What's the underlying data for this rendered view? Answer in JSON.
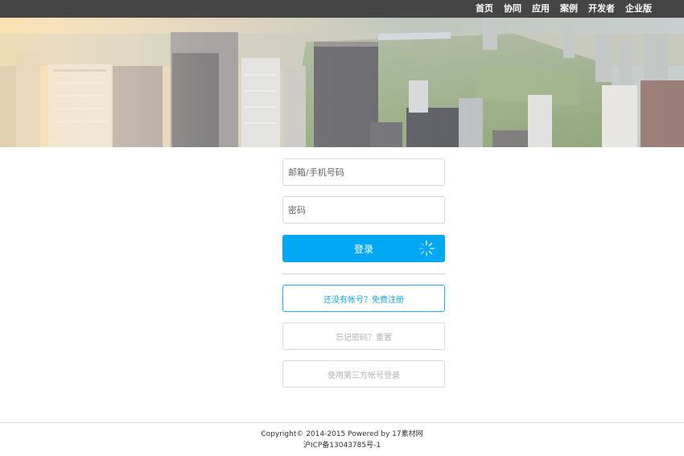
{
  "nav": {
    "items": [
      "首页",
      "协同",
      "应用",
      "案例",
      "开发者",
      "企业版"
    ]
  },
  "login": {
    "email_placeholder": "邮箱/手机号码",
    "password_placeholder": "密码",
    "submit_label": "登录",
    "register_label": "还没有帐号？免费注册",
    "forgot_label": "忘记密码？重置",
    "third_party_label": "使用第三方帐号登录"
  },
  "footer": {
    "copyright": "Copyright© 2014-2015 Powered by 17素材网",
    "icp": "沪ICP备13043785号-1"
  },
  "colors": {
    "topbar": "#454545",
    "primary": "#00a8f3",
    "link": "#1aa7e0"
  }
}
